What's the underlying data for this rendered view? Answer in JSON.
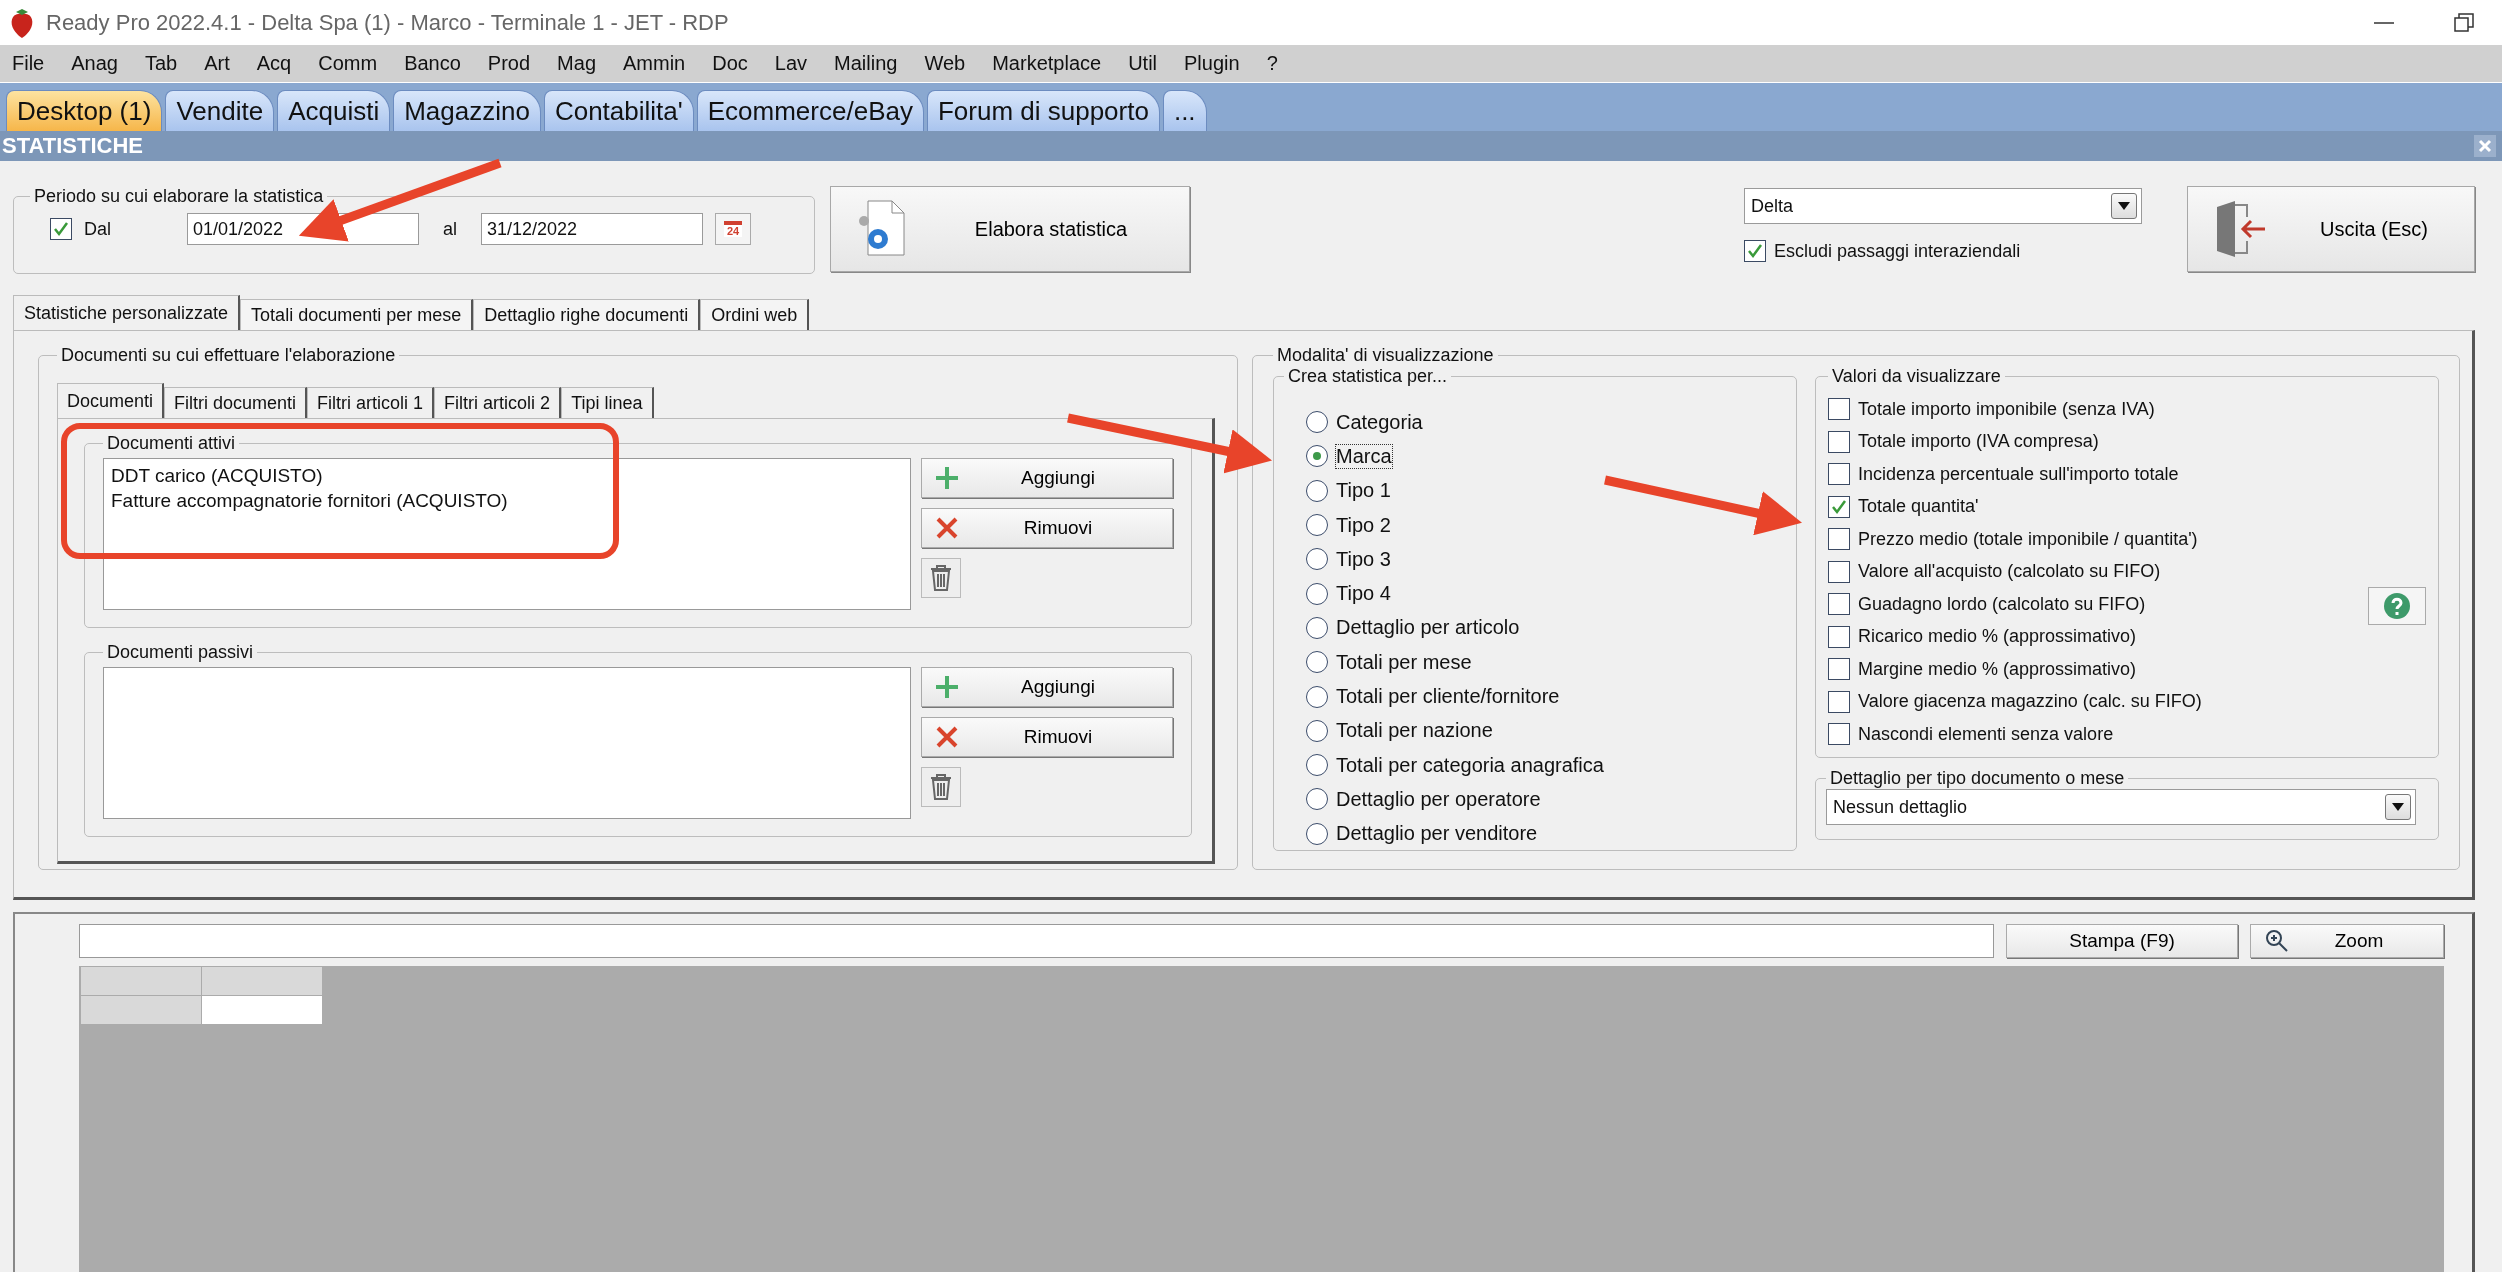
{
  "window": {
    "title": "Ready Pro 2022.4.1 - Delta Spa (1) - Marco - Terminale 1 - JET - RDP"
  },
  "menu": [
    "File",
    "Anag",
    "Tab",
    "Art",
    "Acq",
    "Comm",
    "Banco",
    "Prod",
    "Mag",
    "Ammin",
    "Doc",
    "Lav",
    "Mailing",
    "Web",
    "Marketplace",
    "Util",
    "Plugin",
    "?"
  ],
  "tabs": [
    {
      "label": "Desktop (1)",
      "selected": true
    },
    {
      "label": "Vendite",
      "selected": false
    },
    {
      "label": "Acquisti",
      "selected": false
    },
    {
      "label": "Magazzino",
      "selected": false
    },
    {
      "label": "Contabilita'",
      "selected": false
    },
    {
      "label": "Ecommerce/eBay",
      "selected": false
    },
    {
      "label": "Forum di supporto",
      "selected": false
    },
    {
      "label": "...",
      "selected": false
    }
  ],
  "panel_title": "STATISTICHE",
  "period": {
    "legend": "Periodo su cui elaborare la statistica",
    "from_checked": true,
    "from_label": "Dal",
    "from": "01/01/2022",
    "to_label": "al",
    "to": "31/12/2022",
    "calendar_day": "24"
  },
  "process_button": "Elabora statistica",
  "company": {
    "value": "Delta",
    "exclude": {
      "label": "Escludi passaggi interaziendali",
      "checked": true
    }
  },
  "exit_button": "Uscita (Esc)",
  "view_tabs": [
    {
      "label": "Statistiche personalizzate",
      "selected": true
    },
    {
      "label": "Totali documenti per mese",
      "selected": false
    },
    {
      "label": "Dettaglio righe documenti",
      "selected": false
    },
    {
      "label": "Ordini web",
      "selected": false
    }
  ],
  "documents": {
    "legend": "Documenti su cui effettuare l'elaborazione",
    "subtabs": [
      {
        "label": "Documenti",
        "selected": true
      },
      {
        "label": "Filtri documenti",
        "selected": false
      },
      {
        "label": "Filtri articoli 1",
        "selected": false
      },
      {
        "label": "Filtri articoli 2",
        "selected": false
      },
      {
        "label": "Tipi linea",
        "selected": false
      }
    ],
    "lists": [
      {
        "legend": "Documenti attivi",
        "items": [
          "DDT carico (ACQUISTO)",
          "Fatture accompagnatorie fornitori (ACQUISTO)"
        ],
        "add": "Aggiungi",
        "remove": "Rimuovi"
      },
      {
        "legend": "Documenti passivi",
        "add": "Aggiungi",
        "remove": "Rimuovi"
      }
    ]
  },
  "modes": {
    "legend": "Modalita' di visualizzazione",
    "create": {
      "legend": "Crea statistica per...",
      "options": [
        {
          "label": "Categoria",
          "selected": false
        },
        {
          "label": "Marca",
          "selected": true
        },
        {
          "label": "Tipo 1",
          "selected": false
        },
        {
          "label": "Tipo 2",
          "selected": false
        },
        {
          "label": "Tipo 3",
          "selected": false
        },
        {
          "label": "Tipo 4",
          "selected": false
        },
        {
          "label": "Dettaglio per articolo",
          "selected": false
        },
        {
          "label": "Totali per mese",
          "selected": false
        },
        {
          "label": "Totali per cliente/fornitore",
          "selected": false
        },
        {
          "label": "Totali per nazione",
          "selected": false
        },
        {
          "label": "Totali per categoria anagrafica",
          "selected": false
        },
        {
          "label": "Dettaglio per operatore",
          "selected": false
        },
        {
          "label": "Dettaglio per venditore",
          "selected": false
        }
      ]
    },
    "values": {
      "legend": "Valori da visualizzare",
      "options": [
        {
          "label": "Totale importo imponibile (senza IVA)",
          "checked": false
        },
        {
          "label": "Totale importo (IVA compresa)",
          "checked": false
        },
        {
          "label": "Incidenza percentuale sull'importo totale",
          "checked": false
        },
        {
          "label": "Totale quantita'",
          "checked": true
        },
        {
          "label": "Prezzo medio (totale imponibile / quantita')",
          "checked": false
        },
        {
          "label": "Valore all'acquisto (calcolato su FIFO)",
          "checked": false
        },
        {
          "label": "Guadagno lordo (calcolato su FIFO)",
          "checked": false
        },
        {
          "label": "Ricarico medio % (approssimativo)",
          "checked": false
        },
        {
          "label": "Margine medio % (approssimativo)",
          "checked": false
        },
        {
          "label": "Valore giacenza magazzino (calc. su FIFO)",
          "checked": false
        },
        {
          "label": "Nascondi elementi senza valore",
          "checked": false
        }
      ]
    },
    "detail": {
      "legend": "Dettaglio per tipo documento o mese",
      "value": "Nessun dettaglio"
    }
  },
  "results": {
    "print_button": "Stampa (F9)",
    "zoom_button": "Zoom"
  }
}
